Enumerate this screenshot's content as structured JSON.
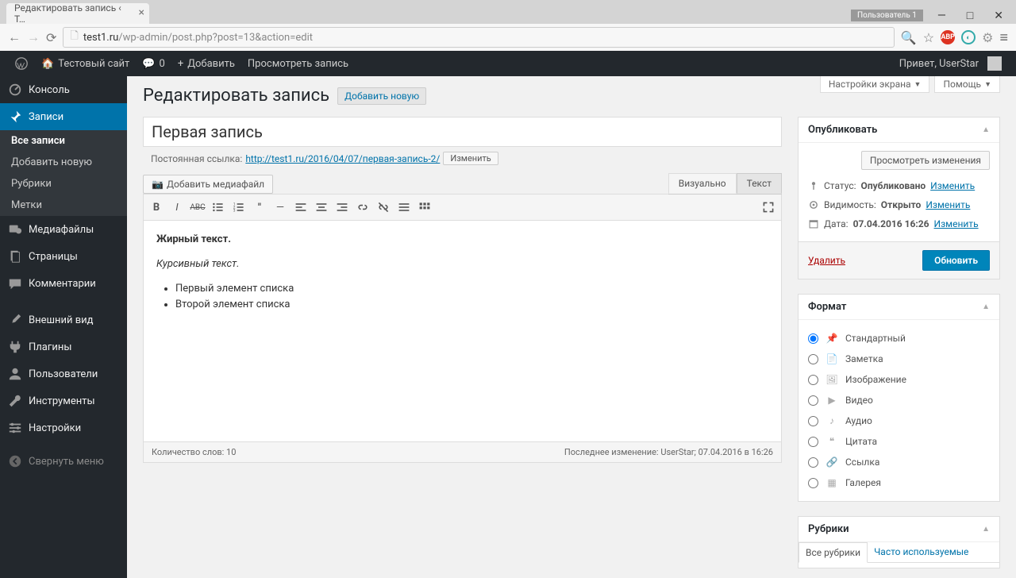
{
  "browser": {
    "tab_title": "Редактировать запись ‹ Т…",
    "url_domain": "test1.ru",
    "url_path": "/wp-admin/post.php?post=13&action=edit",
    "user_badge": "Пользователь 1"
  },
  "adminbar": {
    "site_name": "Тестовый сайт",
    "comments": "0",
    "add_new": "Добавить",
    "view_post": "Просмотреть запись",
    "greeting": "Привет, UserStar"
  },
  "sidebar": {
    "items": [
      {
        "label": "Консоль"
      },
      {
        "label": "Записи",
        "active": true,
        "sub": [
          {
            "label": "Все записи",
            "current": true
          },
          {
            "label": "Добавить новую"
          },
          {
            "label": "Рубрики"
          },
          {
            "label": "Метки"
          }
        ]
      },
      {
        "label": "Медиафайлы"
      },
      {
        "label": "Страницы"
      },
      {
        "label": "Комментарии"
      },
      {
        "label": "Внешний вид"
      },
      {
        "label": "Плагины"
      },
      {
        "label": "Пользователи"
      },
      {
        "label": "Инструменты"
      },
      {
        "label": "Настройки"
      },
      {
        "label": "Свернуть меню"
      }
    ]
  },
  "screen_links": {
    "options": "Настройки экрана",
    "help": "Помощь"
  },
  "page": {
    "title": "Редактировать запись",
    "add_new": "Добавить новую",
    "post_title": "Первая запись",
    "permalink_label": "Постоянная ссылка:",
    "permalink_url": "http://test1.ru/2016/04/07/",
    "permalink_slug": "первая-запись-2/",
    "permalink_edit": "Изменить",
    "media_button": "Добавить медиафайл",
    "tab_visual": "Визуально",
    "tab_text": "Текст",
    "content": {
      "bold": "Жирный текст.",
      "italic": "Курсивный текст.",
      "list": [
        "Первый элемент списка",
        "Второй элемент списка"
      ]
    },
    "word_count": "Количество слов: 10",
    "last_edit": "Последнее изменение: UserStar; 07.04.2016 в 16:26"
  },
  "publish": {
    "title": "Опубликовать",
    "preview": "Просмотреть изменения",
    "status_label": "Статус:",
    "status_value": "Опубликовано",
    "visibility_label": "Видимость:",
    "visibility_value": "Открыто",
    "date_label": "Дата:",
    "date_value": "07.04.2016 16:26",
    "edit": "Изменить",
    "delete": "Удалить",
    "update": "Обновить"
  },
  "format": {
    "title": "Формат",
    "items": [
      "Стандартный",
      "Заметка",
      "Изображение",
      "Видео",
      "Аудио",
      "Цитата",
      "Ссылка",
      "Галерея"
    ]
  },
  "categories": {
    "title": "Рубрики",
    "tab_all": "Все рубрики",
    "tab_popular": "Часто используемые"
  }
}
